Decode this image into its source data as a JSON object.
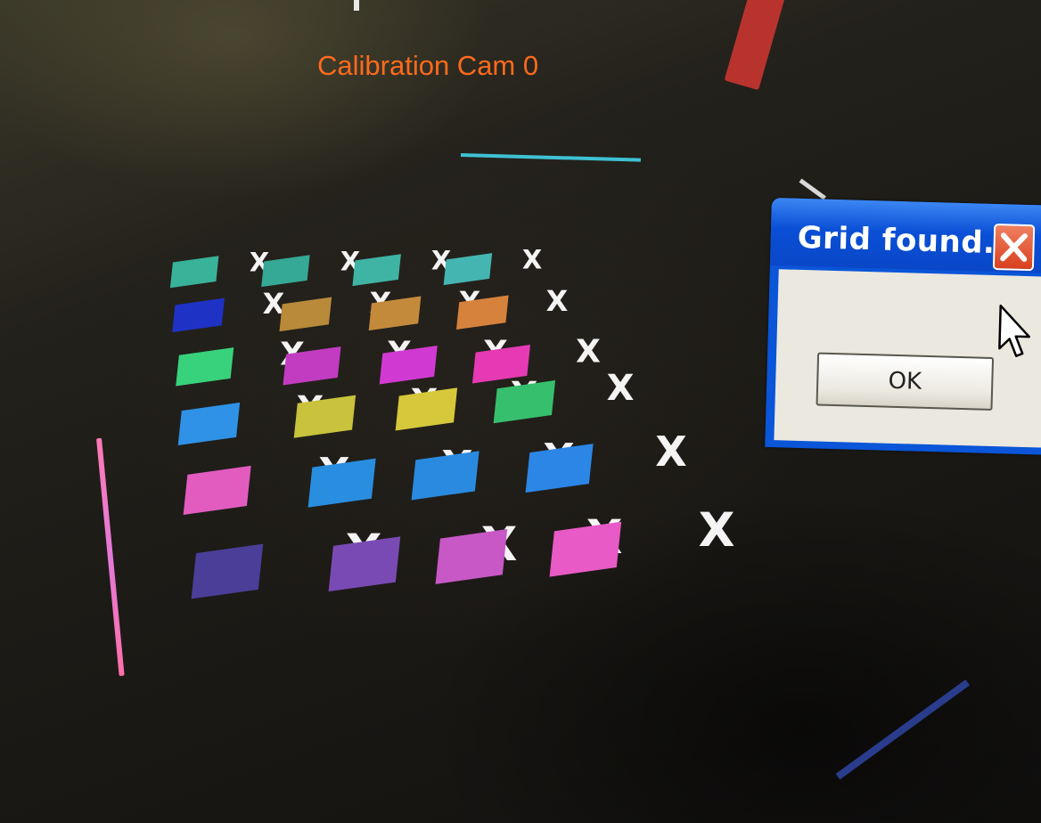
{
  "calibration_title": "Calibration Cam 0",
  "grid_marker_glyph": "X",
  "grid_marker_colors": [
    [
      "#39b29a",
      "#35a896",
      "#3fb3a4",
      "#45b5b2"
    ],
    [
      "#1f32c6",
      "#b88a3a",
      "#c48a3c",
      "#d6823c"
    ],
    [
      "#38d27c",
      "#c23cc2",
      "#d13ad2",
      "#e63ab4"
    ],
    [
      "#2f92e6",
      "#c8c23c",
      "#d6c83a",
      "#36c06e"
    ],
    [
      "#e25cc0",
      "#2a8ee0",
      "#2a8ae0",
      "#2c86e6"
    ],
    [
      "#4a3e98",
      "#7a4ab4",
      "#c858c6",
      "#e85ac6"
    ]
  ],
  "dialog": {
    "title": "Grid found.",
    "ok_label": "OK",
    "close_icon": "close-icon",
    "pointer_icon": "mouse-pointer-icon"
  }
}
